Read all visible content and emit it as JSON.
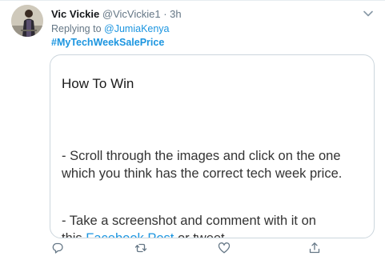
{
  "tweet": {
    "display_name": "Vic Vickie",
    "handle": "@VicVickie1",
    "separator": "·",
    "time": "3h",
    "reply_prefix": "Replying to",
    "reply_to": "@JumiaKenya",
    "hashtag": "#MyTechWeekSalePrice"
  },
  "card": {
    "title": "How To Win",
    "paragraph1": "- Scroll through the images and click on the one which you think has the correct tech week price.",
    "paragraph2": "- Take a screenshot and comment with it on",
    "cut_line_plain": "this",
    "cut_line_link": "Facebook Post",
    "cut_line_tail": "or tweet"
  },
  "icons": {
    "caret": "chevron-down-icon",
    "reply": "reply-icon",
    "retweet": "retweet-icon",
    "like": "heart-icon",
    "share": "share-icon"
  },
  "colors": {
    "link": "#1b95e0",
    "muted": "#657786",
    "border": "#ccd6dd"
  }
}
